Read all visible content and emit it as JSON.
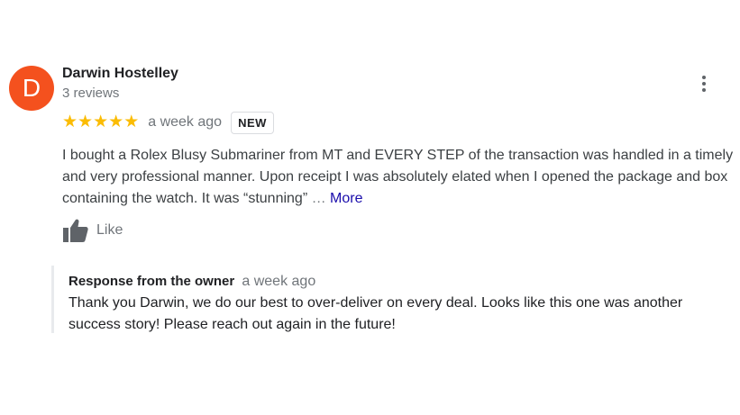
{
  "review": {
    "avatar_letter": "D",
    "avatar_color": "#f4511e",
    "author_name": "Darwin Hostelley",
    "review_count": "3 reviews",
    "menu_icon": "more-vert-icon",
    "rating": 5,
    "rating_max": 5,
    "star_color": "#fbbc04",
    "time": "a week ago",
    "badge": "NEW",
    "text": "I bought a Rolex Blusy Submariner from MT and EVERY STEP of the transaction was handled in a timely and very professional manner. Upon receipt I was absolutely elated when I opened the package and box containing the watch. It was “stunning”",
    "ellipsis": " … ",
    "more_label": "More",
    "like_icon": "thumb-up-icon",
    "like_label": "Like"
  },
  "owner_response": {
    "title": "Response from the owner",
    "time": "a week ago",
    "text": "Thank you Darwin, we do our best to over-deliver on every deal. Looks like this one was another success story! Please reach out again in the future!"
  },
  "colors": {
    "link": "#1a0dab",
    "secondary_text": "#70757a"
  }
}
